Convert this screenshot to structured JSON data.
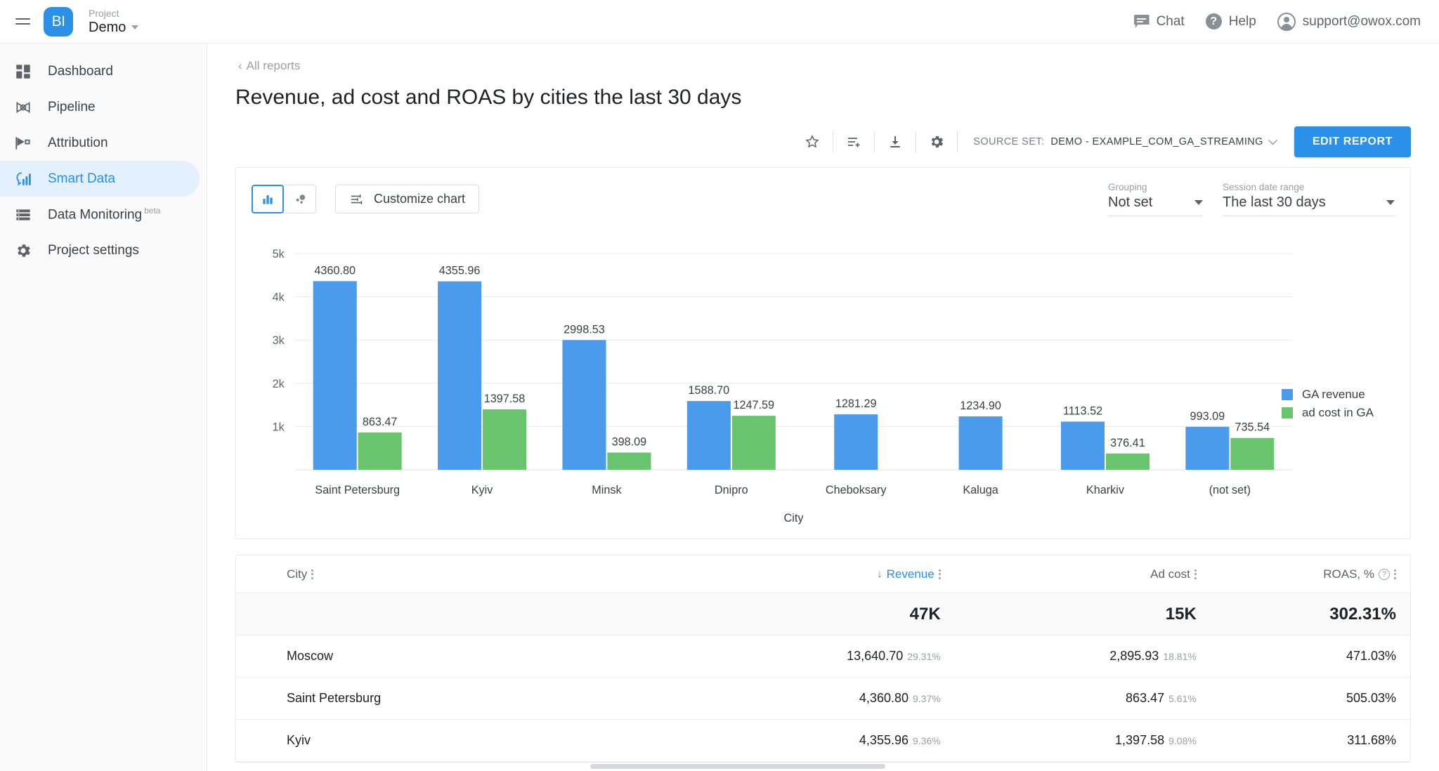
{
  "topbar": {
    "menu_icon": "hamburger-icon",
    "logo_text": "BI",
    "project_label": "Project",
    "project_name": "Demo",
    "chat_label": "Chat",
    "help_label": "Help",
    "help_glyph": "?",
    "account_email": "support@owox.com"
  },
  "sidebar": {
    "items": [
      {
        "label": "Dashboard",
        "icon": "dashboard-icon",
        "active": false
      },
      {
        "label": "Pipeline",
        "icon": "pipeline-icon",
        "active": false
      },
      {
        "label": "Attribution",
        "icon": "attribution-icon",
        "active": false
      },
      {
        "label": "Smart Data",
        "icon": "smart-data-icon",
        "active": true
      },
      {
        "label": "Data Monitoring",
        "icon": "data-monitoring-icon",
        "badge": "beta",
        "active": false
      },
      {
        "label": "Project settings",
        "icon": "gear-icon",
        "active": false
      }
    ]
  },
  "page": {
    "breadcrumb": "All reports",
    "breadcrumb_chevron": "‹",
    "title": "Revenue, ad cost and ROAS by cities the last 30 days"
  },
  "actions": {
    "favorite_icon": "star-icon",
    "add_to_list_icon": "add-to-list-icon",
    "download_icon": "download-icon",
    "settings_icon": "gear-icon",
    "source_set_label": "SOURCE SET:",
    "source_set_value": "DEMO - EXAMPLE_COM_GA_STREAMING",
    "edit_report_label": "EDIT REPORT"
  },
  "chart_controls": {
    "bar_toggle_icon": "bar-chart-icon",
    "bubble_toggle_icon": "bubble-chart-icon",
    "customize_label": "Customize chart",
    "customize_icon": "sliders-icon",
    "grouping_label": "Grouping",
    "grouping_value": "Not set",
    "date_range_label": "Session date range",
    "date_range_value": "The last 30 days"
  },
  "chart_data": {
    "type": "bar",
    "title": "",
    "xlabel": "City",
    "ylabel": "",
    "ylim": [
      0,
      5000
    ],
    "yticks": [
      "1k",
      "2k",
      "3k",
      "4k",
      "5k"
    ],
    "ytick_values": [
      1000,
      2000,
      3000,
      4000,
      5000
    ],
    "grid": true,
    "legend_position": "right",
    "categories": [
      "Saint Petersburg",
      "Kyiv",
      "Minsk",
      "Dnipro",
      "Cheboksary",
      "Kaluga",
      "Kharkiv",
      "(not set)"
    ],
    "series": [
      {
        "name": "GA revenue",
        "color": "#4a9bec",
        "values": [
          4360.8,
          4355.96,
          2998.53,
          1588.7,
          1281.29,
          1234.9,
          1113.52,
          993.09
        ],
        "labels": [
          "4360.80",
          "4355.96",
          "2998.53",
          "1588.70",
          "1281.29",
          "1234.90",
          "1113.52",
          "993.09"
        ]
      },
      {
        "name": "ad cost in GA",
        "color": "#69c46e",
        "values": [
          863.47,
          1397.58,
          398.09,
          1247.59,
          null,
          null,
          376.41,
          735.54
        ],
        "labels": [
          "863.47",
          "1397.58",
          "398.09",
          "1247.59",
          "",
          "",
          "376.41",
          "735.54"
        ]
      }
    ]
  },
  "table": {
    "columns": [
      {
        "label": "City",
        "sorted": false,
        "has_help": false
      },
      {
        "label": "Revenue",
        "sorted": true,
        "sort_arrow": "↓",
        "has_help": false
      },
      {
        "label": "Ad cost",
        "sorted": false,
        "has_help": false
      },
      {
        "label": "ROAS, %",
        "sorted": false,
        "has_help": true,
        "help_glyph": "?"
      }
    ],
    "totals": {
      "city": "",
      "revenue": "47K",
      "ad_cost": "15K",
      "roas": "302.31%"
    },
    "rows": [
      {
        "city": "Moscow",
        "revenue": "13,640.70",
        "revenue_pct": "29.31%",
        "ad_cost": "2,895.93",
        "ad_cost_pct": "18.81%",
        "roas": "471.03%"
      },
      {
        "city": "Saint Petersburg",
        "revenue": "4,360.80",
        "revenue_pct": "9.37%",
        "ad_cost": "863.47",
        "ad_cost_pct": "5.61%",
        "roas": "505.03%"
      },
      {
        "city": "Kyiv",
        "revenue": "4,355.96",
        "revenue_pct": "9.36%",
        "ad_cost": "1,397.58",
        "ad_cost_pct": "9.08%",
        "roas": "311.68%"
      }
    ]
  },
  "colors": {
    "accent": "#2a90e8",
    "revenue_bar": "#4a9bec",
    "ad_cost_bar": "#69c46e",
    "sidebar_active_bg": "#e3f0fd"
  }
}
